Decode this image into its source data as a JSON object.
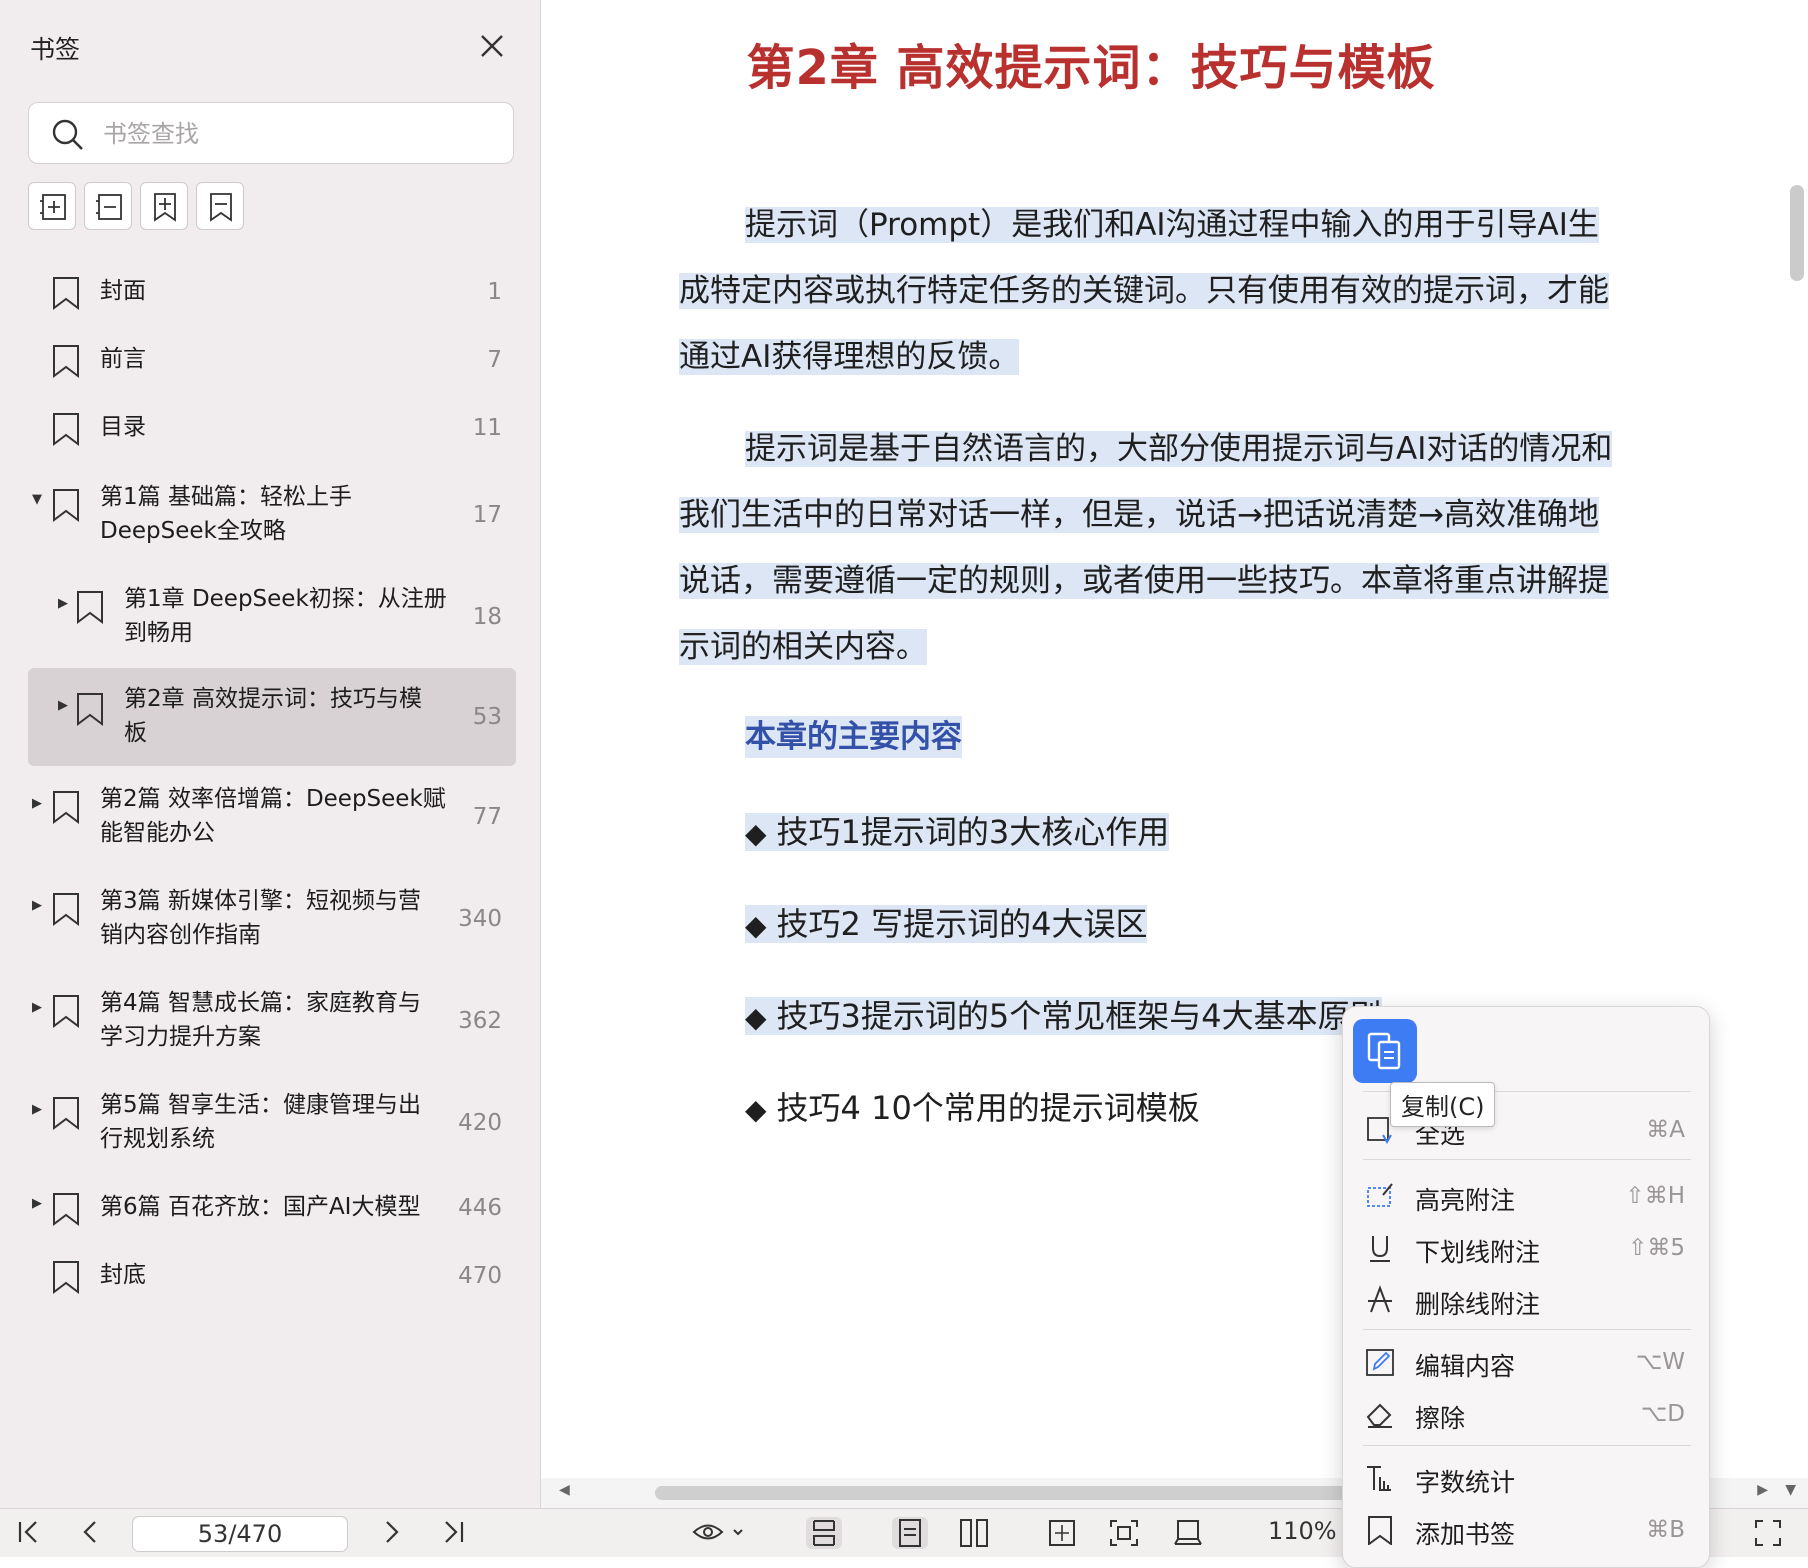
{
  "sidebar": {
    "title": "书签",
    "search_placeholder": "书签查找",
    "bookmarks": [
      {
        "label": "封面",
        "label2": "",
        "page": "1"
      },
      {
        "label": "前言",
        "label2": "",
        "page": "7"
      },
      {
        "label": "目录",
        "label2": "",
        "page": "11"
      },
      {
        "label": "第1篇 基础篇：轻松上手",
        "label2": "DeepSeek全攻略",
        "page": "17"
      },
      {
        "label": "第1章 DeepSeek初探：从注册",
        "label2": "到畅用",
        "page": "18"
      },
      {
        "label": "第2章 高效提示词：技巧与模",
        "label2": "板",
        "page": "53"
      },
      {
        "label": "第2篇 效率倍增篇：DeepSeek赋",
        "label2": "能智能办公",
        "page": "77"
      },
      {
        "label": "第3篇 新媒体引擎：短视频与营",
        "label2": "销内容创作指南",
        "page": "340"
      },
      {
        "label": "第4篇 智慧成长篇：家庭教育与",
        "label2": "学习力提升方案",
        "page": "362"
      },
      {
        "label": "第5篇 智享生活：健康管理与出",
        "label2": "行规划系统",
        "page": "420"
      },
      {
        "label": "第6篇 百花齐放：国产AI大模型",
        "label2": "",
        "page": "446"
      },
      {
        "label": "封底",
        "label2": "",
        "page": "470"
      }
    ]
  },
  "document": {
    "title": "第2章  高效提示词：技巧与模板",
    "para1": [
      "提示词（Prompt）是我们和AI沟通过程中输入的用于引导AI生",
      "成特定内容或执行特定任务的关键词。只有使用有效的提示词，才能",
      "通过AI获得理想的反馈。"
    ],
    "para2": [
      "提示词是基于自然语言的，大部分使用提示词与AI对话的情况和",
      "我们生活中的日常对话一样，但是，说话→把话说清楚→高效准确地",
      "说话，需要遵循一定的规则，或者使用一些技巧。本章将重点讲解提",
      "示词的相关内容。"
    ],
    "section_heading": "本章的主要内容",
    "bullet_symbol": "◆",
    "bullets": [
      "技巧1提示词的3大核心作用",
      "技巧2  写提示词的4大误区",
      "技巧3提示词的5个常见框架与4大基本原则",
      "技巧4  10个常用的提示词模板"
    ]
  },
  "toolbar": {
    "page_indicator": "53/470",
    "zoom": "110%"
  },
  "context_menu": {
    "tooltip": "复制(C)",
    "items": [
      {
        "label": "全选",
        "shortcut": "⌘A",
        "icon": "select-all-icon"
      },
      {
        "label": "高亮附注",
        "shortcut": "⇧⌘H",
        "icon": "highlight-icon"
      },
      {
        "label": "下划线附注",
        "shortcut": "⇧⌘5",
        "icon": "underline-icon"
      },
      {
        "label": "删除线附注",
        "shortcut": "",
        "icon": "strikethrough-icon"
      },
      {
        "label": "编辑内容",
        "shortcut": "⌥W",
        "icon": "edit-icon"
      },
      {
        "label": "擦除",
        "shortcut": "⌥D",
        "icon": "eraser-icon"
      },
      {
        "label": "字数统计",
        "shortcut": "",
        "icon": "word-count-icon"
      },
      {
        "label": "添加书签",
        "shortcut": "⌘B",
        "icon": "add-bookmark-icon"
      }
    ]
  },
  "colors": {
    "title_red": "#b8312f",
    "heading_blue": "#3351a8",
    "selection": "#dce6f5",
    "accent_blue": "#3d7cf2"
  }
}
